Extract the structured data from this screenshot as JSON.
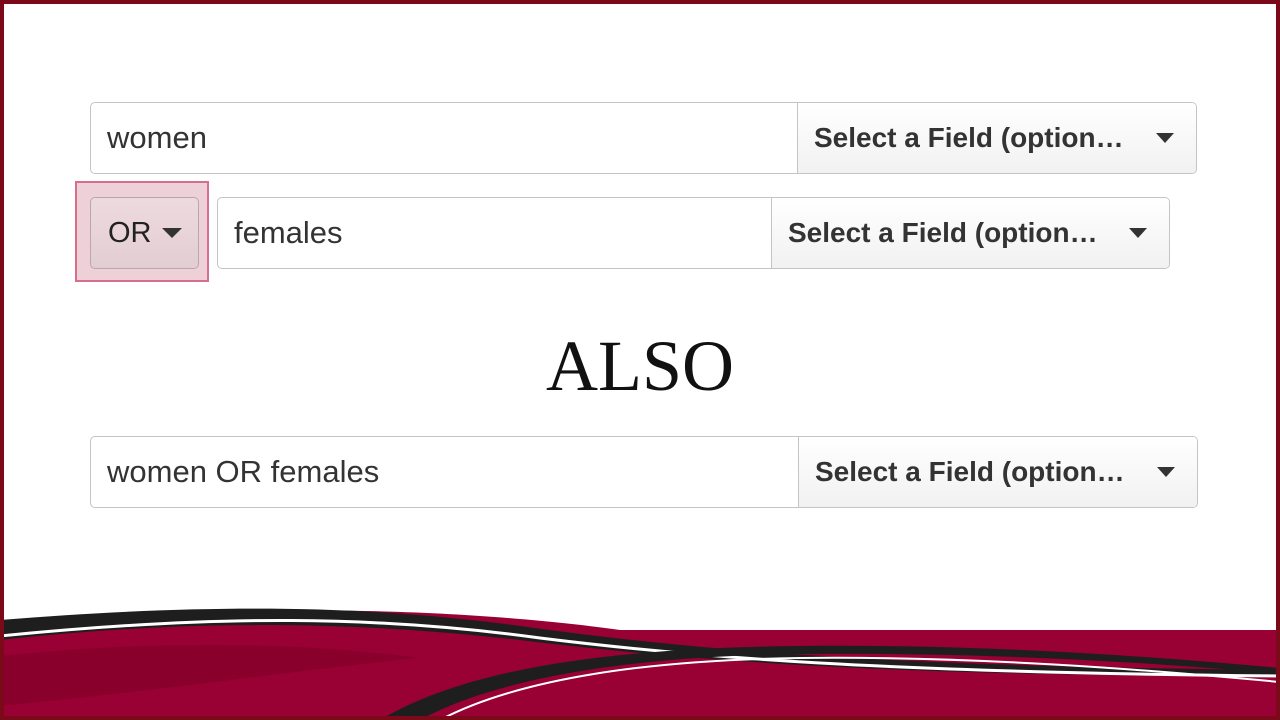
{
  "search_rows": [
    {
      "query": "women",
      "field_label": "Select a Field (option…"
    },
    {
      "operator": "OR",
      "query": "females",
      "field_label": "Select a Field (option…"
    },
    {
      "query": "women OR females",
      "field_label": "Select a Field (option…"
    }
  ],
  "divider_heading": "ALSO",
  "colors": {
    "brand": "#990033",
    "highlight": "#e0aaba",
    "wave_dark": "#1a1a1a"
  },
  "icons": {
    "dropdown": "caret-down-icon"
  }
}
